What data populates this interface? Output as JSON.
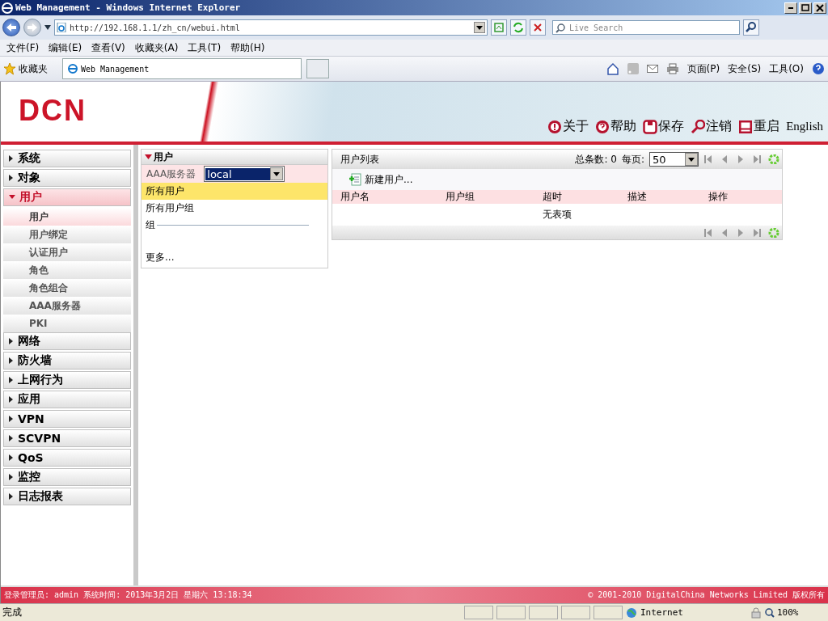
{
  "browser": {
    "title": "Web Management - Windows Internet Explorer",
    "address": "http://192.168.1.1/zh_cn/webui.html",
    "search_placeholder": "Live Search",
    "menu": [
      "文件(F)",
      "编辑(E)",
      "查看(V)",
      "收藏夹(A)",
      "工具(T)",
      "帮助(H)"
    ],
    "favorites": "收藏夹",
    "tab": "Web Management",
    "commands": [
      "页面(P)",
      "安全(S)",
      "工具(O)"
    ]
  },
  "header": {
    "logo": "DCN",
    "links": [
      {
        "kind": "about",
        "label": "关于"
      },
      {
        "kind": "help",
        "label": "帮助"
      },
      {
        "kind": "save",
        "label": "保存"
      },
      {
        "kind": "logout",
        "label": "注销"
      },
      {
        "kind": "restart",
        "label": "重启"
      }
    ],
    "language": "English"
  },
  "sidebar": {
    "items": [
      {
        "label": "系统",
        "expanded": false
      },
      {
        "label": "对象",
        "expanded": false
      },
      {
        "label": "用户",
        "expanded": true,
        "children": [
          {
            "label": "用户",
            "selected": true
          },
          {
            "label": "用户绑定",
            "selected": false
          },
          {
            "label": "认证用户",
            "selected": false
          },
          {
            "label": "角色",
            "selected": false
          },
          {
            "label": "角色组合",
            "selected": false
          },
          {
            "label": "AAA服务器",
            "selected": false
          },
          {
            "label": "PKI",
            "selected": false
          }
        ]
      },
      {
        "label": "网络",
        "expanded": false
      },
      {
        "label": "防火墙",
        "expanded": false
      },
      {
        "label": "上网行为",
        "expanded": false
      },
      {
        "label": "应用",
        "expanded": false
      },
      {
        "label": "VPN",
        "expanded": false
      },
      {
        "label": "SCVPN",
        "expanded": false
      },
      {
        "label": "QoS",
        "expanded": false
      },
      {
        "label": "监控",
        "expanded": false
      },
      {
        "label": "日志报表",
        "expanded": false
      }
    ]
  },
  "user_panel": {
    "title": "用户",
    "server_label": "AAA服务器",
    "server_value": "local",
    "items": [
      {
        "label": "所有用户",
        "selected": true
      },
      {
        "label": "所有用户组",
        "selected": false
      }
    ],
    "group_label": "组",
    "more": "更多..."
  },
  "user_list": {
    "title": "用户列表",
    "total": "总条数: 0",
    "per_page_label": "每页:",
    "per_page": "50",
    "new_button": "新建用户...",
    "columns": [
      "用户名",
      "用户组",
      "超时",
      "描述",
      "操作"
    ],
    "empty": "无表项"
  },
  "footer": {
    "login": "登录管理员: admin 系统时间: 2013年3月2日 星期六 13:18:34",
    "copyright": "© 2001-2010 DigitalChina Networks Limited 版权所有"
  },
  "status_bar": {
    "text": "完成",
    "zone": "Internet",
    "zoom": "100%"
  }
}
